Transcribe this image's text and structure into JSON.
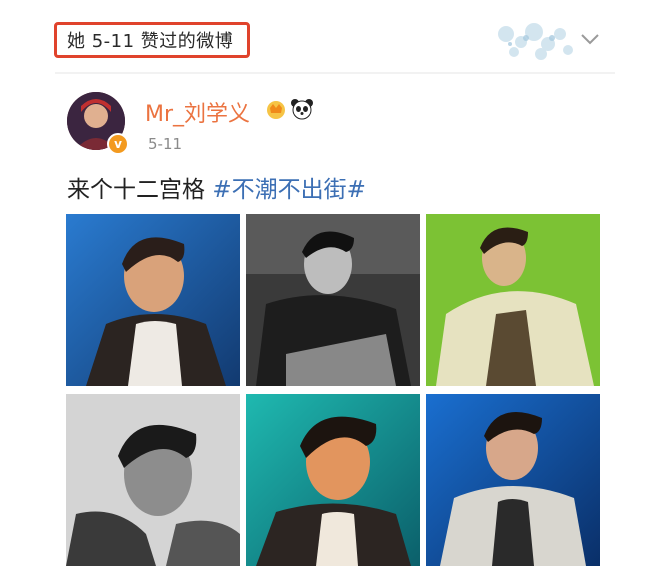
{
  "header": {
    "liked_label": "她 5-11 赞过的微博"
  },
  "post": {
    "username": "Mr_刘学义",
    "date": "5-11",
    "text": "来个十二宫格 ",
    "hashtag": "#不潮不出街#",
    "verified_mark": "v",
    "badges": [
      "crown-badge-icon",
      "panda-badge-icon"
    ]
  },
  "photos": [
    {
      "name": "photo-1",
      "style": "blue background, dark jacket, white shirt"
    },
    {
      "name": "photo-2",
      "style": "black and white, sitting pose"
    },
    {
      "name": "photo-3",
      "style": "green background, light jacket"
    },
    {
      "name": "photo-4",
      "style": "black and white close-up"
    },
    {
      "name": "photo-5",
      "style": "teal and orange warm light"
    },
    {
      "name": "photo-6",
      "style": "blue background, light jacket"
    }
  ],
  "colors": {
    "accent_orange": "#eb7340",
    "hashtag_blue": "#3c6fb4",
    "highlight_red": "#e0432c",
    "verified_orange": "#f39a1f"
  }
}
